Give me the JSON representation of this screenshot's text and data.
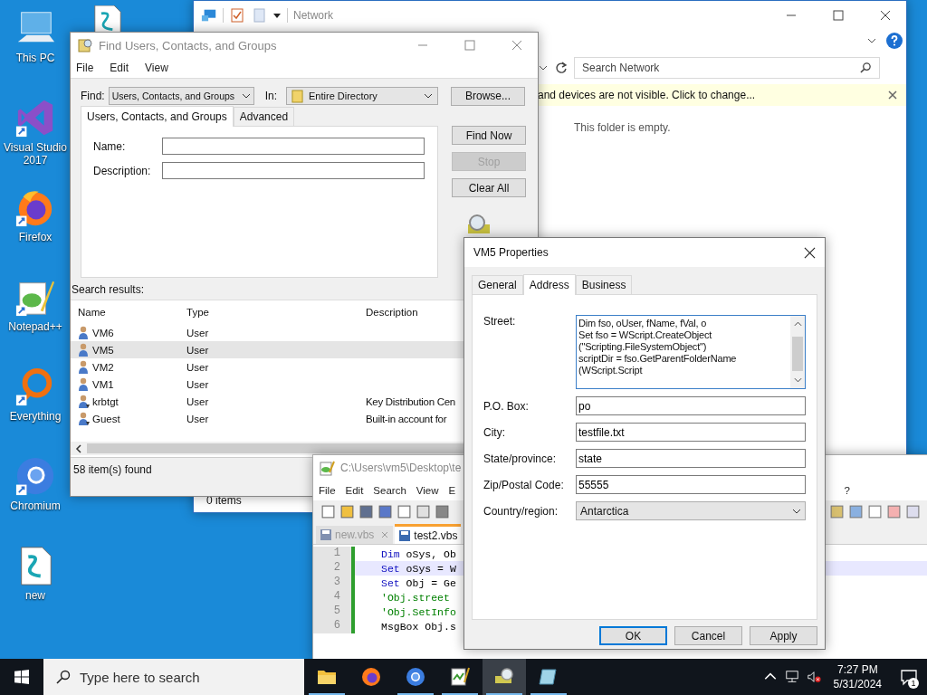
{
  "desktop_icons": [
    {
      "label": "This PC",
      "kind": "computer",
      "shortcut": false
    },
    {
      "label": "Visual Studio 2017",
      "kind": "visual-studio",
      "shortcut": true
    },
    {
      "label": "Firefox",
      "kind": "firefox",
      "shortcut": true
    },
    {
      "label": "Notepad++",
      "kind": "notepad",
      "shortcut": true
    },
    {
      "label": "Everything",
      "kind": "everything",
      "shortcut": true
    },
    {
      "label": "Chromium",
      "kind": "chromium",
      "shortcut": true
    },
    {
      "label": "new",
      "kind": "script",
      "shortcut": false
    }
  ],
  "network_window": {
    "title": "Network",
    "search": {
      "placeholder": "Search Network"
    },
    "info_bar": "and devices are not visible. Click to change...",
    "empty_message": "This folder is empty.",
    "status": "0 items"
  },
  "find_window": {
    "title": "Find Users, Contacts, and Groups",
    "menu": [
      "File",
      "Edit",
      "View"
    ],
    "find_label": "Find:",
    "find_value": "Users, Contacts, and Groups",
    "in_label": "In:",
    "in_value": "Entire Directory",
    "browse": "Browse...",
    "tabs": [
      {
        "label": "Users, Contacts, and Groups",
        "selected": true
      },
      {
        "label": "Advanced",
        "selected": false
      }
    ],
    "fields": [
      {
        "label": "Name:"
      },
      {
        "label": "Description:"
      }
    ],
    "buttons": [
      {
        "label": "Find Now",
        "disabled": false
      },
      {
        "label": "Stop",
        "disabled": true
      },
      {
        "label": "Clear All",
        "disabled": false
      }
    ],
    "results_label": "Search results:",
    "columns": [
      "Name",
      "Type",
      "Description"
    ],
    "rows": [
      {
        "name": "VM6",
        "type": "User",
        "description": "",
        "kind": "user",
        "selected": false
      },
      {
        "name": "VM5",
        "type": "User",
        "description": "",
        "kind": "user",
        "selected": true
      },
      {
        "name": "VM2",
        "type": "User",
        "description": "",
        "kind": "user",
        "selected": false
      },
      {
        "name": "VM1",
        "type": "User",
        "description": "",
        "kind": "user",
        "selected": false
      },
      {
        "name": "krbtgt",
        "type": "User",
        "description": "Key Distribution Cen",
        "kind": "disabled-user",
        "selected": false
      },
      {
        "name": "Guest",
        "type": "User",
        "description": "Built-in account for",
        "kind": "disabled-user",
        "selected": false
      }
    ],
    "status": "58 item(s) found"
  },
  "notepad_window": {
    "title": "C:\\Users\\vm5\\Desktop\\te",
    "menu": [
      "File",
      "Edit",
      "Search",
      "View",
      "E"
    ],
    "help_menu": "?",
    "tabs": [
      {
        "label": "new.vbs",
        "selected": false
      },
      {
        "label": "test2.vbs",
        "selected": true
      }
    ],
    "lines": [
      {
        "number": "1",
        "keyword": "Dim",
        "text": "oSys, Ob",
        "kind": "statement"
      },
      {
        "number": "2",
        "keyword": "Set",
        "text": "oSys = W",
        "kind": "statement"
      },
      {
        "number": "3",
        "keyword": "Set",
        "text": "Obj = Ge",
        "kind": "statement"
      },
      {
        "number": "4",
        "text": "'Obj.street",
        "kind": "comment"
      },
      {
        "number": "5",
        "text": "'Obj.SetInfo",
        "kind": "comment"
      },
      {
        "number": "6",
        "text": "MsgBox Obj.s",
        "kind": "plain"
      }
    ]
  },
  "properties_dialog": {
    "title": "VM5 Properties",
    "tabs": [
      {
        "label": "General",
        "selected": false
      },
      {
        "label": "Address",
        "selected": true
      },
      {
        "label": "Business",
        "selected": false
      }
    ],
    "street_label": "Street:",
    "street_lines": [
      "Dim fso, oUser, fName, fVal, o",
      "Set fso = WScript.CreateObject",
      "(\"Scripting.FileSystemObject\")",
      "scriptDir = fso.GetParentFolderName",
      "(WScript.Script"
    ],
    "fields": [
      {
        "label": "P.O. Box:",
        "value": "po"
      },
      {
        "label": "City:",
        "value": "testfile.txt"
      },
      {
        "label": "State/province:",
        "value": "state"
      },
      {
        "label": "Zip/Postal Code:",
        "value": "55555"
      }
    ],
    "country": {
      "label": "Country/region:",
      "value": "Antarctica"
    },
    "buttons": [
      {
        "label": "OK",
        "default": true
      },
      {
        "label": "Cancel",
        "default": false
      },
      {
        "label": "Apply",
        "default": false
      }
    ]
  },
  "taskbar": {
    "search": {
      "placeholder": "Type here to search"
    },
    "apps": [
      {
        "kind": "folder",
        "active": false,
        "running": true
      },
      {
        "kind": "firefox",
        "active": false,
        "running": false
      },
      {
        "kind": "chromium",
        "active": false,
        "running": true
      },
      {
        "kind": "notepad",
        "active": false,
        "running": true
      },
      {
        "kind": "find",
        "active": true,
        "running": true
      },
      {
        "kind": "notes",
        "active": false,
        "running": true
      }
    ],
    "time": "7:27 PM",
    "date": "5/31/2024",
    "notifications": "1"
  }
}
